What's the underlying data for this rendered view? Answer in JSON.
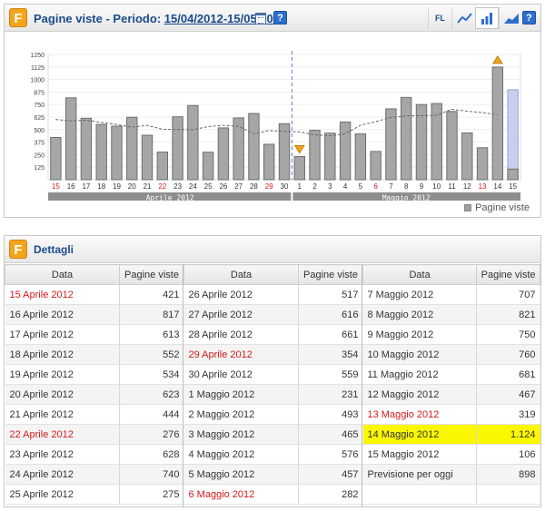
{
  "header": {
    "title": "Pagine viste - Periodo:",
    "period": "15/04/2012-15/05/2012",
    "toolbar": {
      "fl_label": "FL",
      "icons": [
        "line-chart-icon",
        "bar-chart-icon",
        "area-chart-icon",
        "help-icon"
      ],
      "active": "bar-chart-icon"
    }
  },
  "chart_data": {
    "type": "bar",
    "categories": [
      "15",
      "16",
      "17",
      "18",
      "19",
      "20",
      "21",
      "22",
      "23",
      "24",
      "25",
      "26",
      "27",
      "28",
      "29",
      "30",
      "1",
      "2",
      "3",
      "4",
      "5",
      "6",
      "7",
      "8",
      "9",
      "10",
      "11",
      "12",
      "13",
      "14",
      "15"
    ],
    "weekend_categories_index": [
      0,
      7,
      14,
      21,
      28
    ],
    "series": [
      {
        "name": "Pagine viste",
        "values": [
          421,
          817,
          613,
          552,
          534,
          623,
          444,
          276,
          628,
          740,
          275,
          517,
          616,
          661,
          354,
          559,
          231,
          493,
          465,
          576,
          457,
          282,
          707,
          821,
          750,
          760,
          681,
          467,
          319,
          1124,
          106
        ]
      }
    ],
    "forecast": {
      "value": 898
    },
    "trend_line": "moving-average",
    "y_ticks": [
      125,
      250,
      375,
      500,
      625,
      750,
      875,
      1000,
      1125,
      1250
    ],
    "ylim": [
      0,
      1250
    ],
    "months": [
      "Aprile 2012",
      "Maggio 2012"
    ],
    "max_marker_index": 29,
    "min_marker_index": 16,
    "legend": "Pagine viste",
    "colors": {
      "bar": "#a6a6a6",
      "bar_border": "#6e6e6e",
      "forecast": "#c8cef0",
      "weekend_label": "#d21a1a",
      "month_bar": "#8e8e8e",
      "trend": "#666666",
      "divider": "#5b7fd6"
    }
  },
  "details": {
    "title": "Dettagli",
    "col_date": "Data",
    "col_views": "Pagine viste",
    "columns": [
      [
        {
          "date": "15 Aprile 2012",
          "views": "421",
          "red": true
        },
        {
          "date": "16 Aprile 2012",
          "views": "817"
        },
        {
          "date": "17 Aprile 2012",
          "views": "613"
        },
        {
          "date": "18 Aprile 2012",
          "views": "552"
        },
        {
          "date": "19 Aprile 2012",
          "views": "534"
        },
        {
          "date": "20 Aprile 2012",
          "views": "623"
        },
        {
          "date": "21 Aprile 2012",
          "views": "444"
        },
        {
          "date": "22 Aprile 2012",
          "views": "276",
          "red": true
        },
        {
          "date": "23 Aprile 2012",
          "views": "628"
        },
        {
          "date": "24 Aprile 2012",
          "views": "740"
        },
        {
          "date": "25 Aprile 2012",
          "views": "275"
        }
      ],
      [
        {
          "date": "26 Aprile 2012",
          "views": "517"
        },
        {
          "date": "27 Aprile 2012",
          "views": "616"
        },
        {
          "date": "28 Aprile 2012",
          "views": "661"
        },
        {
          "date": "29 Aprile 2012",
          "views": "354",
          "red": true
        },
        {
          "date": "30 Aprile 2012",
          "views": "559"
        },
        {
          "date": "1 Maggio 2012",
          "views": "231"
        },
        {
          "date": "2 Maggio 2012",
          "views": "493"
        },
        {
          "date": "3 Maggio 2012",
          "views": "465"
        },
        {
          "date": "4 Maggio 2012",
          "views": "576"
        },
        {
          "date": "5 Maggio 2012",
          "views": "457"
        },
        {
          "date": "6 Maggio 2012",
          "views": "282",
          "red": true
        }
      ],
      [
        {
          "date": "7 Maggio 2012",
          "views": "707"
        },
        {
          "date": "8 Maggio 2012",
          "views": "821"
        },
        {
          "date": "9 Maggio 2012",
          "views": "750"
        },
        {
          "date": "10 Maggio 2012",
          "views": "760"
        },
        {
          "date": "11 Maggio 2012",
          "views": "681"
        },
        {
          "date": "12 Maggio 2012",
          "views": "467"
        },
        {
          "date": "13 Maggio 2012",
          "views": "319",
          "red": true
        },
        {
          "date": "14 Maggio 2012",
          "views": "1.124",
          "highlight": true
        },
        {
          "date": "15 Maggio 2012",
          "views": "106"
        },
        {
          "date": "Previsione per oggi",
          "views": "898"
        },
        {
          "date": "",
          "views": ""
        }
      ]
    ]
  }
}
